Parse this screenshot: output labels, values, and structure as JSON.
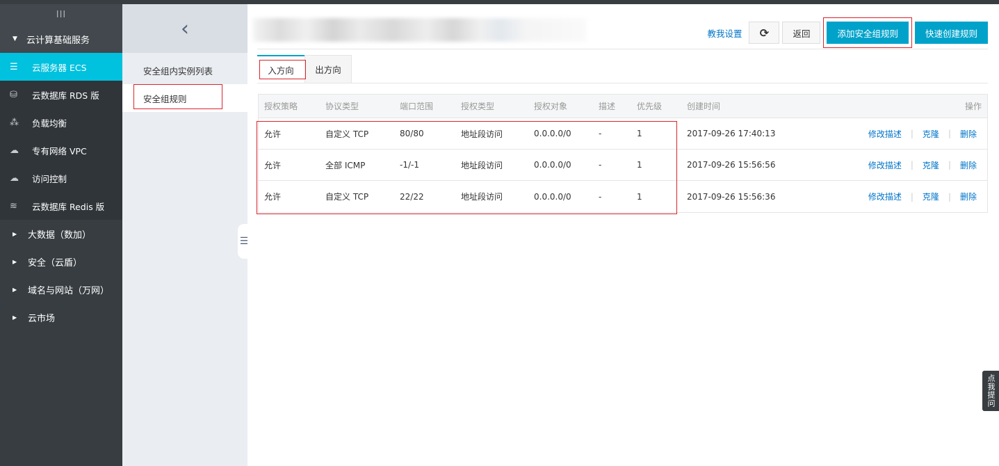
{
  "sidebar": {
    "toggle_glyph": "III",
    "group_label": "云计算基础服务",
    "items": [
      {
        "label": "云服务器 ECS",
        "icon": "server-icon",
        "active": true
      },
      {
        "label": "云数据库 RDS 版",
        "icon": "database-icon",
        "active": false
      },
      {
        "label": "负载均衡",
        "icon": "load-balancer-icon",
        "active": false
      },
      {
        "label": "专有网络 VPC",
        "icon": "cloud-network-icon",
        "active": false
      },
      {
        "label": "访问控制",
        "icon": "cloud-key-icon",
        "active": false
      },
      {
        "label": "云数据库 Redis 版",
        "icon": "redis-layers-icon",
        "active": false
      }
    ],
    "subgroups": [
      {
        "label": "大数据（数加）"
      },
      {
        "label": "安全（云盾）"
      },
      {
        "label": "域名与网站（万网）"
      },
      {
        "label": "云市场"
      }
    ]
  },
  "subnav": {
    "items": [
      {
        "label": "安全组内实例列表",
        "active": false
      },
      {
        "label": "安全组规则",
        "active": true
      }
    ]
  },
  "header": {
    "help_link": "教我设置",
    "refresh_icon": "refresh-icon",
    "back_label": "返回",
    "add_rule_label": "添加安全组规则",
    "quick_create_label": "快速创建规则"
  },
  "tabs": [
    {
      "label": "入方向",
      "active": true
    },
    {
      "label": "出方向",
      "active": false
    }
  ],
  "table": {
    "columns": [
      "授权策略",
      "协议类型",
      "端口范围",
      "授权类型",
      "授权对象",
      "描述",
      "优先级",
      "创建时间",
      "操作"
    ],
    "rows": [
      {
        "policy": "允许",
        "protocol": "自定义 TCP",
        "port": "80/80",
        "auth_type": "地址段访问",
        "target": "0.0.0.0/0",
        "desc": "-",
        "priority": "1",
        "created": "2017-09-26 17:40:13"
      },
      {
        "policy": "允许",
        "protocol": "全部 ICMP",
        "port": "-1/-1",
        "auth_type": "地址段访问",
        "target": "0.0.0.0/0",
        "desc": "-",
        "priority": "1",
        "created": "2017-09-26 15:56:56"
      },
      {
        "policy": "允许",
        "protocol": "自定义 TCP",
        "port": "22/22",
        "auth_type": "地址段访问",
        "target": "0.0.0.0/0",
        "desc": "-",
        "priority": "1",
        "created": "2017-09-26 15:56:36"
      }
    ],
    "actions": {
      "edit": "修改描述",
      "clone": "克隆",
      "delete": "删除"
    }
  },
  "help_float": "点我提问",
  "colors": {
    "accent": "#00c1de",
    "primary_button": "#00a2ca",
    "link": "#0074c8",
    "sidebar_bg": "#373d41",
    "highlight_box": "#d9242b"
  }
}
